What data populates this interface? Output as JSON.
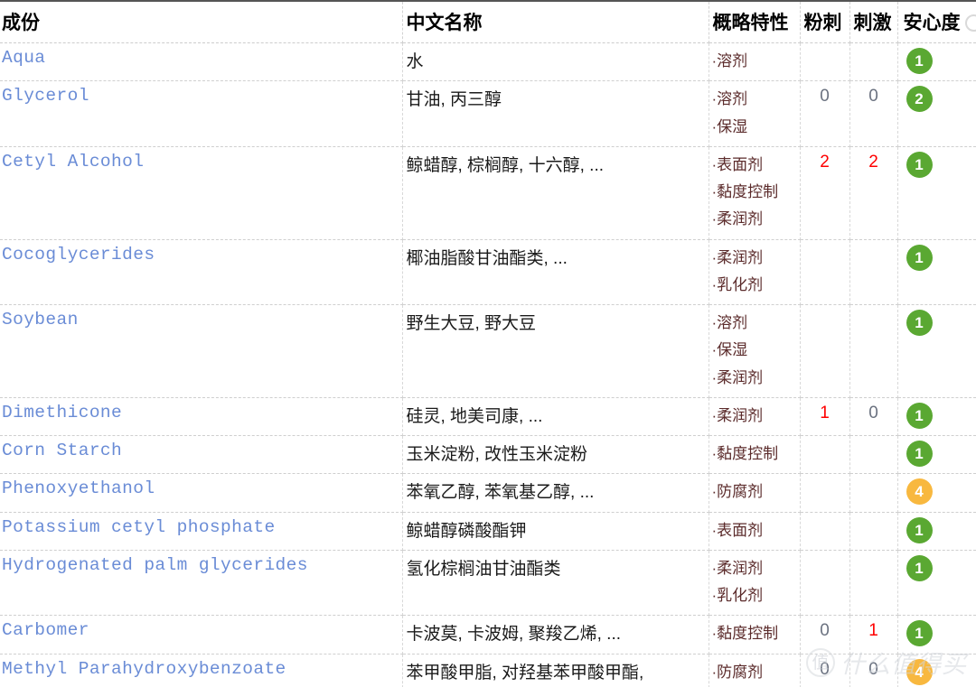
{
  "table": {
    "columns": [
      {
        "key": "en",
        "label": "成份"
      },
      {
        "key": "zh",
        "label": "中文名称"
      },
      {
        "key": "feat",
        "label": "概略特性"
      },
      {
        "key": "acne",
        "label": "粉刺"
      },
      {
        "key": "irr",
        "label": "刺激"
      },
      {
        "key": "safe",
        "label": "安心度"
      }
    ],
    "help_icon": "question-circle-icon",
    "rows": [
      {
        "en": "Aqua",
        "zh": "水",
        "features": [
          "·溶剂"
        ],
        "acne": "",
        "irritation": "",
        "safety": "1",
        "safety_color": "green"
      },
      {
        "en": "Glycerol",
        "zh": "甘油, 丙三醇",
        "features": [
          "·溶剂",
          "·保湿"
        ],
        "acne": "0",
        "irritation": "0",
        "safety": "2",
        "safety_color": "green"
      },
      {
        "en": "Cetyl Alcohol",
        "zh": "鲸蜡醇, 棕榈醇, 十六醇, ...",
        "features": [
          "·表面剂",
          "·黏度控制",
          "·柔润剂"
        ],
        "acne": "2",
        "irritation": "2",
        "safety": "1",
        "safety_color": "green"
      },
      {
        "en": "Cocoglycerides",
        "zh": "椰油脂酸甘油酯类, ...",
        "features": [
          "·柔润剂",
          "·乳化剂"
        ],
        "acne": "",
        "irritation": "",
        "safety": "1",
        "safety_color": "green"
      },
      {
        "en": "Soybean",
        "zh": "野生大豆, 野大豆",
        "features": [
          "·溶剂",
          "·保湿",
          "·柔润剂"
        ],
        "acne": "",
        "irritation": "",
        "safety": "1",
        "safety_color": "green"
      },
      {
        "en": "Dimethicone",
        "zh": "硅灵, 地美司康, ...",
        "features": [
          "·柔润剂"
        ],
        "acne": "1",
        "irritation": "0",
        "safety": "1",
        "safety_color": "green"
      },
      {
        "en": "Corn Starch",
        "zh": "玉米淀粉, 改性玉米淀粉",
        "features": [
          "·黏度控制"
        ],
        "acne": "",
        "irritation": "",
        "safety": "1",
        "safety_color": "green"
      },
      {
        "en": "Phenoxyethanol",
        "zh": "苯氧乙醇, 苯氧基乙醇, ...",
        "features": [
          "·防腐剂"
        ],
        "acne": "",
        "irritation": "",
        "safety": "4",
        "safety_color": "orange"
      },
      {
        "en": "Potassium cetyl phosphate",
        "zh": "鲸蜡醇磷酸酯钾",
        "features": [
          "·表面剂"
        ],
        "acne": "",
        "irritation": "",
        "safety": "1",
        "safety_color": "green"
      },
      {
        "en": "Hydrogenated palm glycerides",
        "zh": "氢化棕榈油甘油酯类",
        "features": [
          "·柔润剂",
          "·乳化剂"
        ],
        "acne": "",
        "irritation": "",
        "safety": "1",
        "safety_color": "green"
      },
      {
        "en": "Carbomer",
        "zh": "卡波莫, 卡波姆, 聚羧乙烯, ...",
        "features": [
          "·黏度控制"
        ],
        "acne": "0",
        "irritation": "1",
        "safety": "1",
        "safety_color": "green"
      },
      {
        "en": "Methyl Parahydroxybenzoate",
        "zh": "苯甲酸甲脂, 对羟基苯甲酸甲酯,",
        "features": [
          "·防腐剂"
        ],
        "acne": "0",
        "irritation": "0",
        "safety": "4",
        "safety_color": "orange"
      }
    ]
  },
  "watermark": {
    "logo_text": "值",
    "text": "什么值得买"
  },
  "colors": {
    "link": "#6a8cd6",
    "safe_green": "#5aa832",
    "safe_orange": "#f8b83f",
    "warn_red": "#ff0000",
    "zero_gray": "#6b7280",
    "feature_text": "#5b2b2b"
  }
}
